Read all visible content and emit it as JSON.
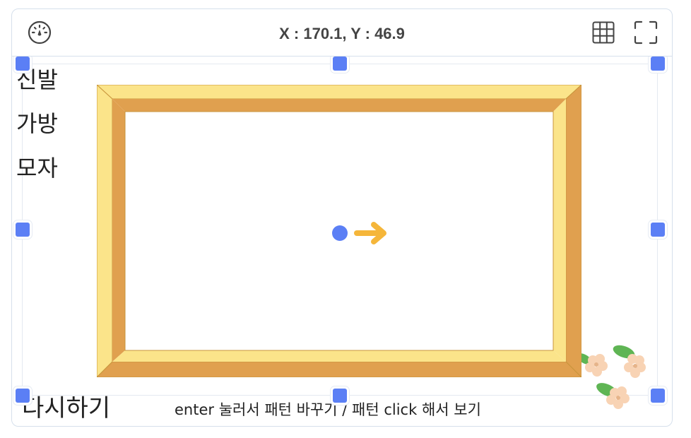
{
  "toolbar": {
    "speed_icon": "speedometer-icon",
    "grid_icon": "grid-icon",
    "fullscreen_icon": "fullscreen-icon",
    "coords": {
      "x_label": "X : ",
      "x_value": "170.1",
      "separator": ", ",
      "y_label": "Y : ",
      "y_value": "46.9"
    }
  },
  "stage": {
    "menu": [
      {
        "label": "신발"
      },
      {
        "label": "가방"
      },
      {
        "label": "모자"
      }
    ],
    "restart_label": "다시하기",
    "hint": "enter 눌러서 패턴 바꾸기 / 패턴 click 해서 보기",
    "colors": {
      "handle": "#5b7ff5",
      "frame_light": "#fbe48a",
      "frame_dark": "#e0a04f",
      "arrow": "#f5b63a",
      "dot": "#5b7ff5",
      "leaf": "#5fb554",
      "flower": "#f8d3b4"
    }
  }
}
